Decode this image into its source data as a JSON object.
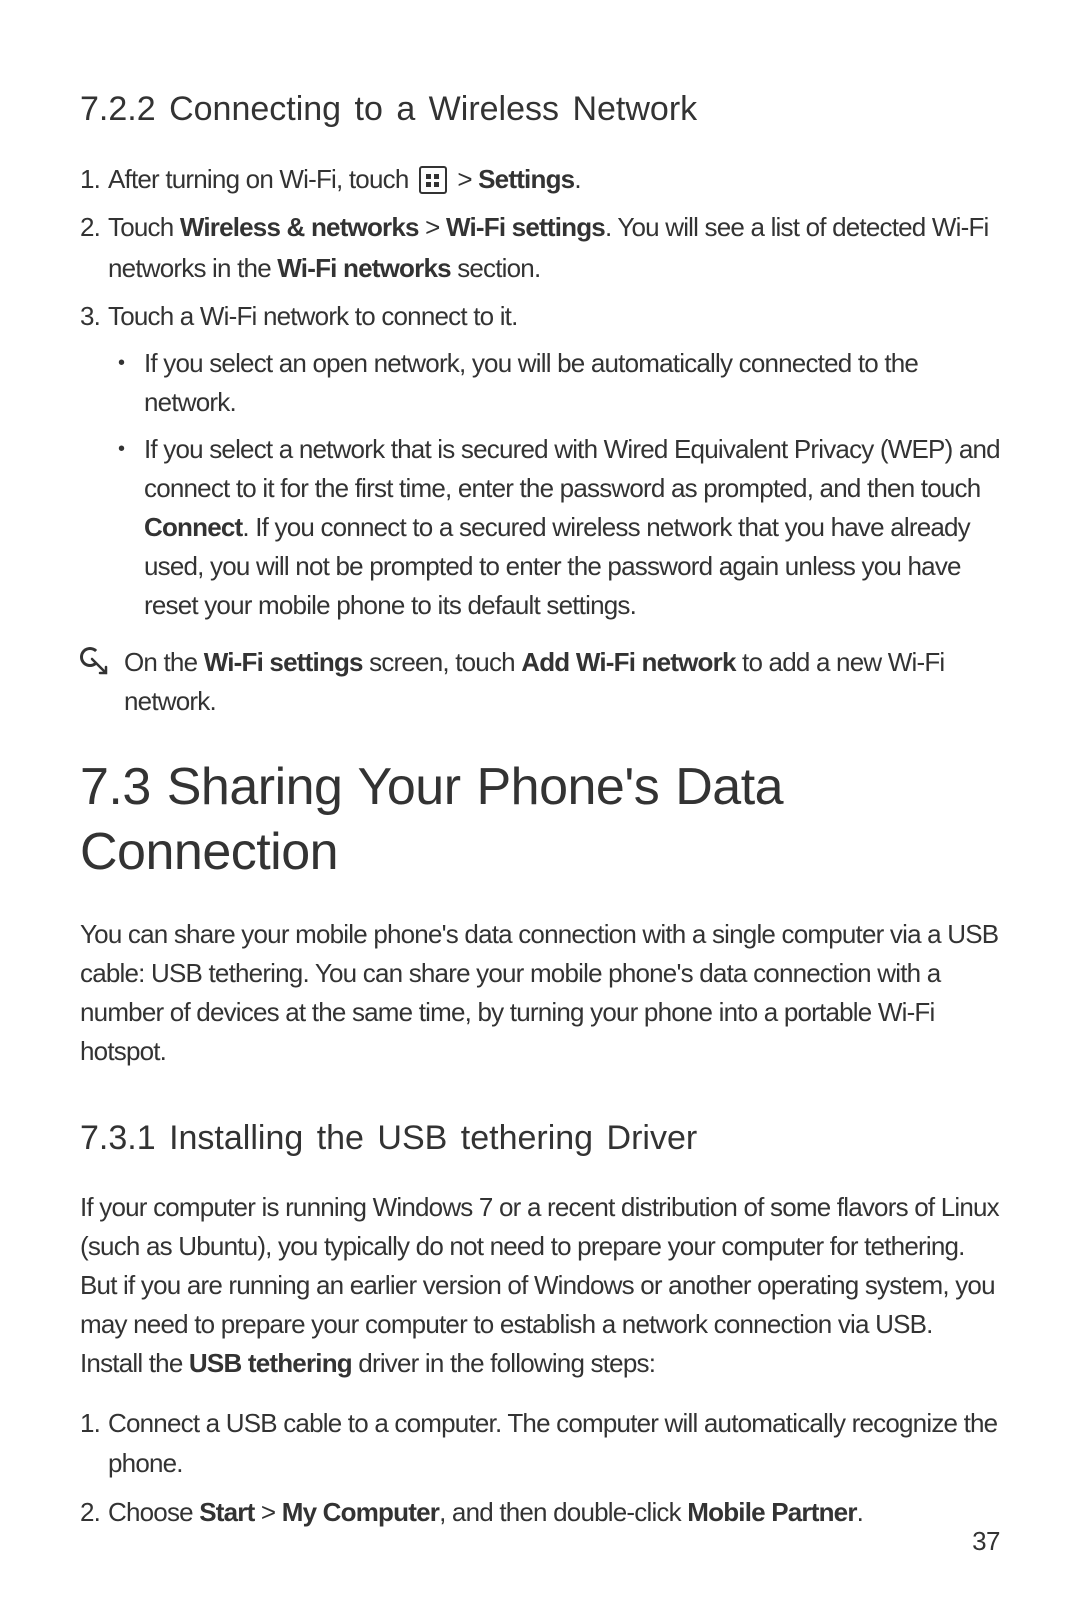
{
  "section722": {
    "heading": "7.2.2  Connecting to a Wireless Network",
    "items": [
      {
        "num": "1.",
        "parts": [
          {
            "t": "After turning on Wi-Fi, touch ",
            "b": false
          },
          {
            "icon": "apps"
          },
          {
            "t": "  > ",
            "b": false
          },
          {
            "t": "Settings",
            "b": true
          },
          {
            "t": ".",
            "b": false
          }
        ]
      },
      {
        "num": "2.",
        "parts": [
          {
            "t": "Touch ",
            "b": false
          },
          {
            "t": "Wireless & networks",
            "b": true
          },
          {
            "t": " > ",
            "b": false
          },
          {
            "t": "Wi-Fi settings",
            "b": true
          },
          {
            "t": ". You will see a list of detected Wi-Fi networks in the ",
            "b": false
          },
          {
            "t": "Wi-Fi networks",
            "b": true
          },
          {
            "t": " section.",
            "b": false
          }
        ]
      },
      {
        "num": "3.",
        "parts": [
          {
            "t": "Touch a Wi-Fi network to connect to it.",
            "b": false
          }
        ],
        "bullets": [
          {
            "parts": [
              {
                "t": "If you select an open network, you will be automatically connected to the network.",
                "b": false
              }
            ]
          },
          {
            "parts": [
              {
                "t": "If you select a network that is secured with Wired Equivalent Privacy (WEP) and connect to it for the first time, enter the password as prompted, and then touch ",
                "b": false
              },
              {
                "t": "Connect",
                "b": true
              },
              {
                "t": ". If you connect to a secured wireless network that you have already used, you will not be prompted to enter the password again unless you have reset your mobile phone to its default settings.",
                "b": false
              }
            ]
          }
        ]
      }
    ],
    "note": {
      "parts": [
        {
          "t": "On the ",
          "b": false
        },
        {
          "t": "Wi-Fi settings",
          "b": true
        },
        {
          "t": " screen, touch ",
          "b": false
        },
        {
          "t": "Add Wi-Fi network",
          "b": true
        },
        {
          "t": " to add a new Wi-Fi network.",
          "b": false
        }
      ]
    }
  },
  "section73": {
    "heading": "7.3  Sharing Your Phone's Data Connection",
    "intro": "You can share your mobile phone's data connection with a single computer via a USB cable: USB tethering. You can share your mobile phone's data connection with a number of devices at the same time, by turning your phone into a portable Wi-Fi hotspot."
  },
  "section731": {
    "heading": "7.3.1  Installing the USB tethering Driver",
    "intro": {
      "parts": [
        {
          "t": "If your computer is running Windows 7 or a recent distribution of some flavors of Linux (such as Ubuntu), you typically do not need to prepare your computer for tethering. But if you are running an earlier version of Windows or another operating system, you may need to prepare your computer to establish a network connection via USB. Install the ",
          "b": false
        },
        {
          "t": "USB tethering",
          "b": true
        },
        {
          "t": " driver in the following steps:",
          "b": false
        }
      ]
    },
    "items": [
      {
        "num": "1.",
        "parts": [
          {
            "t": "Connect a USB cable to a computer. The computer will automatically recognize the phone.",
            "b": false
          }
        ]
      },
      {
        "num": "2.",
        "parts": [
          {
            "t": "Choose ",
            "b": false
          },
          {
            "t": "Start",
            "b": true
          },
          {
            "t": " > ",
            "b": false
          },
          {
            "t": "My Computer",
            "b": true
          },
          {
            "t": ", and then double-click ",
            "b": false
          },
          {
            "t": "Mobile Partner",
            "b": true
          },
          {
            "t": ".",
            "b": false
          }
        ]
      }
    ]
  },
  "page_number": "37"
}
